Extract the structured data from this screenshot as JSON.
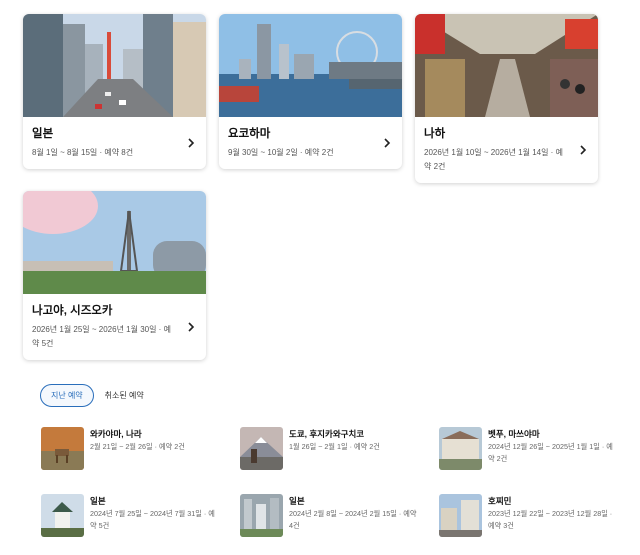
{
  "upcoming": [
    {
      "title": "일본",
      "detail": "8월 1일 ~ 8월 15일 · 예약 8건",
      "image": "tokyo-street-photo"
    },
    {
      "title": "요코하마",
      "detail": "9월 30일 ~ 10월 2일 · 예약 2건",
      "image": "yokohama-harbor-photo"
    },
    {
      "title": "나하",
      "detail": "2026년 1월 10일 ~ 2026년 1월 14일 · 예약 2건",
      "image": "naha-market-photo"
    },
    {
      "title": "나고야, 시즈오카",
      "detail": "2026년 1월 25일 ~ 2026년 1월 30일 · 예약 5건",
      "image": "nagoya-tower-photo"
    }
  ],
  "tabs": {
    "past": "지난 예약",
    "cancelled": "취소된 예약"
  },
  "past": [
    {
      "title": "와카야마, 나라",
      "detail": "2월 21일 ~ 2월 26일 · 예약 2건",
      "image": "nara-deer-photo"
    },
    {
      "title": "도쿄, 후지카와구치코",
      "detail": "1월 26일 ~ 2월 1일 · 예약 2건",
      "image": "mount-fuji-photo"
    },
    {
      "title": "벳푸, 마쓰야마",
      "detail": "2024년 12월 26일 ~ 2025년 1월 1일 · 예약 2건",
      "image": "beppu-town-photo"
    },
    {
      "title": "일본",
      "detail": "2024년 7월 25일 ~ 2024년 7월 31일 · 예약 5건",
      "image": "osaka-castle-photo"
    },
    {
      "title": "일본",
      "detail": "2024년 2월 8일 ~ 2024년 2월 15일 · 예약 4건",
      "image": "city-aerial-photo"
    },
    {
      "title": "호찌민",
      "detail": "2023년 12월 22일 ~ 2023년 12월 28일 · 예약 3건",
      "image": "hochiminh-street-photo"
    }
  ]
}
